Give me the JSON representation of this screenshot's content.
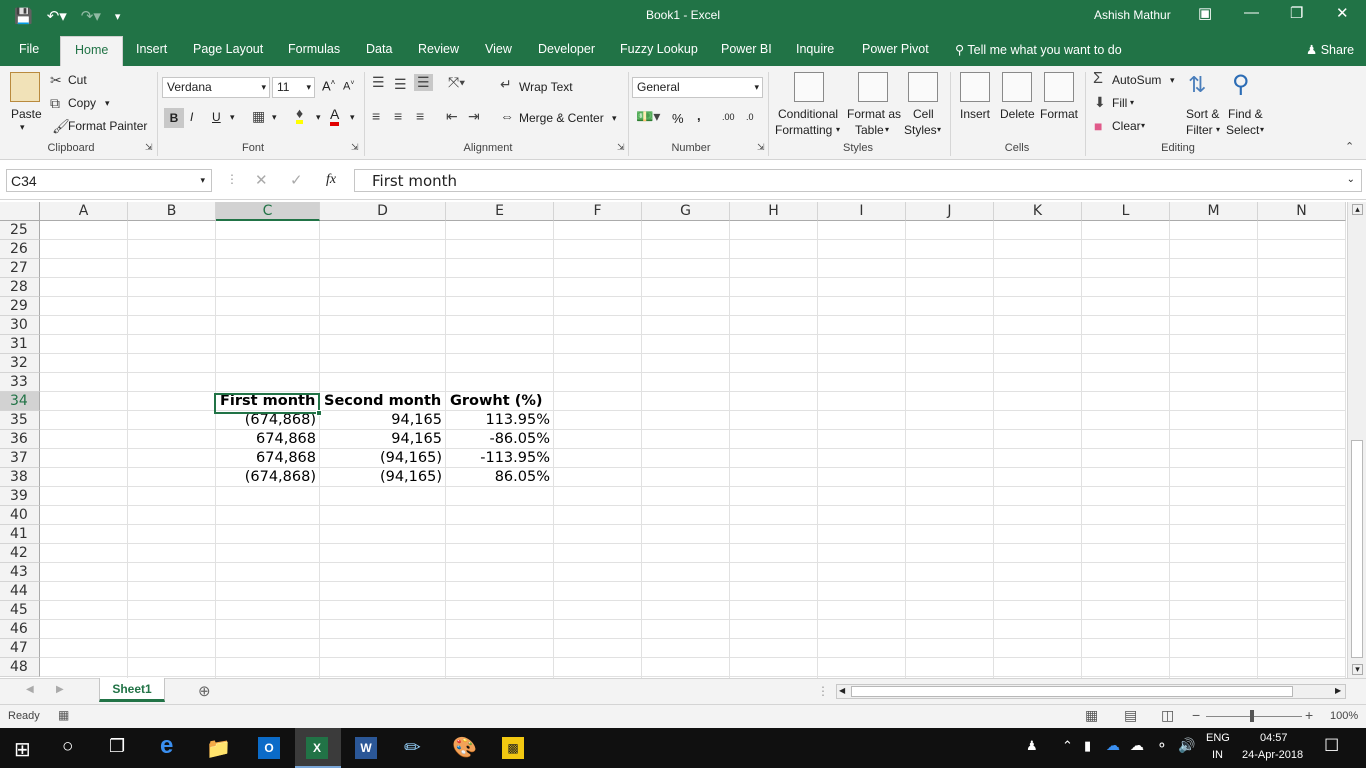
{
  "window": {
    "title": "Book1  -  Excel",
    "user": "Ashish Mathur",
    "min_icon": "minimize-icon",
    "restore_icon": "restore-icon",
    "close_icon": "close-icon"
  },
  "tabs": [
    "File",
    "Home",
    "Insert",
    "Page Layout",
    "Formulas",
    "Data",
    "Review",
    "View",
    "Developer",
    "Fuzzy Lookup",
    "Power BI",
    "Inquire",
    "Power Pivot"
  ],
  "tell_me": "Tell me what you want to do",
  "share": "Share",
  "ribbon": {
    "clipboard": {
      "label": "Clipboard",
      "paste": "Paste",
      "cut": "Cut",
      "copy": "Copy",
      "format_painter": "Format Painter"
    },
    "font": {
      "label": "Font",
      "name": "Verdana",
      "size": "11",
      "bold": "B",
      "italic": "I",
      "underline": "U"
    },
    "alignment": {
      "label": "Alignment",
      "wrap": "Wrap Text",
      "merge": "Merge & Center"
    },
    "number": {
      "label": "Number",
      "format": "General",
      "percent": "%",
      "comma": ",",
      "inc": ".00",
      "dec": ".0"
    },
    "styles": {
      "label": "Styles",
      "cond1": "Conditional",
      "cond2": "Formatting",
      "fat1": "Format as",
      "fat2": "Table",
      "cs1": "Cell",
      "cs2": "Styles"
    },
    "cells": {
      "label": "Cells",
      "insert": "Insert",
      "delete": "Delete",
      "format": "Format"
    },
    "editing": {
      "label": "Editing",
      "autosum": "AutoSum",
      "fill": "Fill",
      "clear": "Clear",
      "sort1": "Sort &",
      "sort2": "Filter",
      "find1": "Find &",
      "find2": "Select"
    }
  },
  "formula_bar": {
    "name_box": "C34",
    "content": "First month",
    "fx": "fx"
  },
  "grid": {
    "columns": [
      "A",
      "B",
      "C",
      "D",
      "E",
      "F",
      "G",
      "H",
      "I",
      "J",
      "K",
      "L",
      "M",
      "N"
    ],
    "rows": [
      "25",
      "26",
      "27",
      "28",
      "29",
      "30",
      "31",
      "32",
      "33",
      "34",
      "35",
      "36",
      "37",
      "38",
      "39",
      "40",
      "41",
      "42",
      "43",
      "44",
      "45",
      "46",
      "47",
      "48"
    ],
    "selected_column": "C",
    "selected_row": "34",
    "table": {
      "headers": [
        "First month",
        "Second month",
        "Growht (%)"
      ],
      "rows": [
        [
          "(674,868)",
          "94,165",
          "113.95%"
        ],
        [
          "674,868",
          "94,165",
          "-86.05%"
        ],
        [
          "674,868",
          "(94,165)",
          "-113.95%"
        ],
        [
          "(674,868)",
          "(94,165)",
          "86.05%"
        ]
      ]
    }
  },
  "sheets": [
    "Sheet1"
  ],
  "status": {
    "ready": "Ready",
    "zoom": "100%"
  },
  "taskbar": {
    "lang1": "ENG",
    "lang2": "IN",
    "time": "04:57",
    "date": "24-Apr-2018"
  },
  "colors": {
    "excel_green": "#217346",
    "ribbon_bg": "#f3f3f3"
  }
}
